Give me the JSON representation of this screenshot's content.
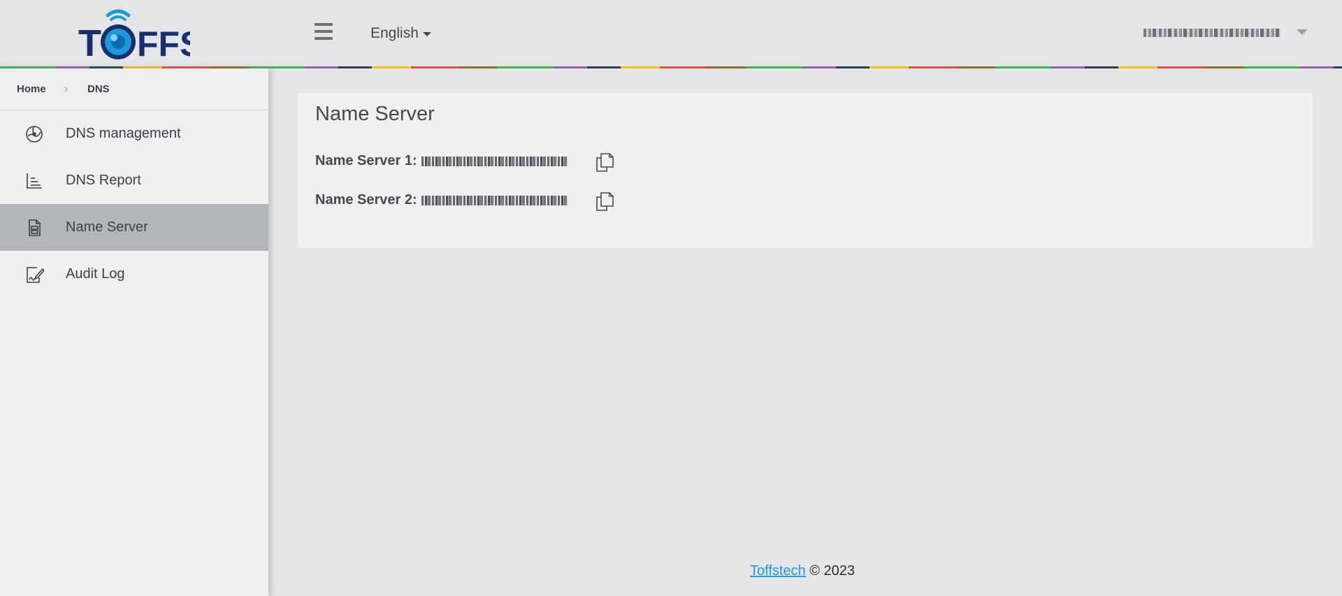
{
  "header": {
    "logo_text": "TOFFS",
    "language": "English",
    "user_name": "",
    "menu_icon": "hamburger-icon",
    "colors": {
      "rainbow": [
        "#39b54a",
        "#9b59b6",
        "#2c3e50",
        "#f1c40f",
        "#e74c3c",
        "#8b6f1d"
      ],
      "logo_blue": "#1a2f6e",
      "logo_accent": "#1c9ad6"
    }
  },
  "breadcrumb": {
    "items": [
      "Home",
      "DNS"
    ],
    "separator": "›"
  },
  "sidebar": {
    "items": [
      {
        "label": "DNS management",
        "icon": "dns-globe-icon",
        "active": false
      },
      {
        "label": "DNS Report",
        "icon": "bar-chart-icon",
        "active": false
      },
      {
        "label": "Name Server",
        "icon": "server-doc-icon",
        "active": true
      },
      {
        "label": "Audit Log",
        "icon": "signature-doc-icon",
        "active": false
      }
    ],
    "active_color": "#b2b6ba"
  },
  "main": {
    "title": "Name Server",
    "name_servers": [
      {
        "label": "Name Server 1:",
        "value": "",
        "copy_icon": "copy-icon"
      },
      {
        "label": "Name Server 2:",
        "value": "",
        "copy_icon": "copy-icon"
      }
    ]
  },
  "footer": {
    "link_text": "Toffstech",
    "copyright": "© 2023"
  }
}
